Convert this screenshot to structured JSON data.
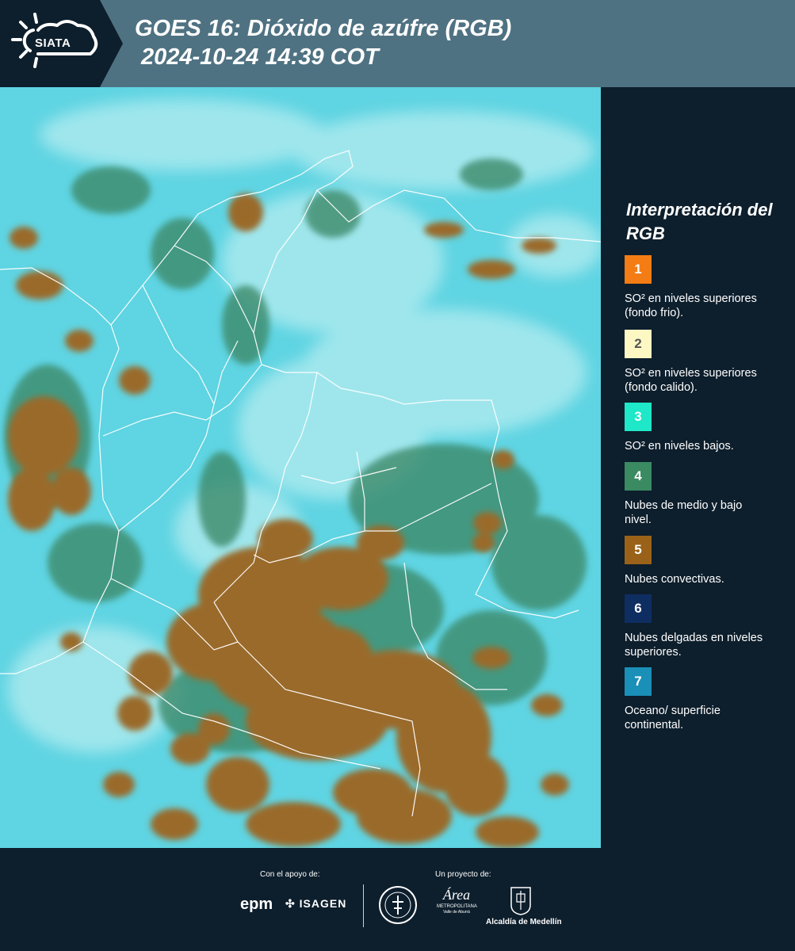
{
  "header": {
    "logo_text": "SIATA",
    "title_line1": "GOES 16: Dióxido de azúfre (RGB)",
    "title_line2": "2024-10-24 14:39 COT"
  },
  "map": {
    "background_color": "#5fd4e2",
    "cloud_color": "#9a6a2a",
    "midcloud_color": "#3c8a6a",
    "border_color": "#ffffff"
  },
  "legend": {
    "title": "Interpretación del RGB",
    "items": [
      {
        "number": "1",
        "color": "#f47c14",
        "text_color": "#ffffff",
        "label": "SO² en niveles superiores (fondo frio)."
      },
      {
        "number": "2",
        "color": "#fdf7c4",
        "text_color": "#555555",
        "label": "SO² en niveles superiores (fondo calido)."
      },
      {
        "number": "3",
        "color": "#1ee8c8",
        "text_color": "#ffffff",
        "label": "SO² en niveles bajos."
      },
      {
        "number": "4",
        "color": "#3a8a62",
        "text_color": "#ffffff",
        "label": "Nubes de medio y bajo nivel."
      },
      {
        "number": "5",
        "color": "#9a6218",
        "text_color": "#ffffff",
        "label": "Nubes convectivas."
      },
      {
        "number": "6",
        "color": "#0e2e62",
        "text_color": "#ffffff",
        "label": "Nubes delgadas en niveles superiores."
      },
      {
        "number": "7",
        "color": "#1a8fb8",
        "text_color": "#ffffff",
        "label": "Oceano/ superficie continental."
      }
    ]
  },
  "footer": {
    "support_label": "Con el apoyo de:",
    "project_label": "Un proyecto de:",
    "epm": "epm",
    "isagen": "ISAGEN",
    "area_name": "Área",
    "area_subtitle": "METROPOLITANA",
    "area_subtitle2": "Valle de Aburrá",
    "alcaldia": "Alcaldía de Medellín"
  }
}
